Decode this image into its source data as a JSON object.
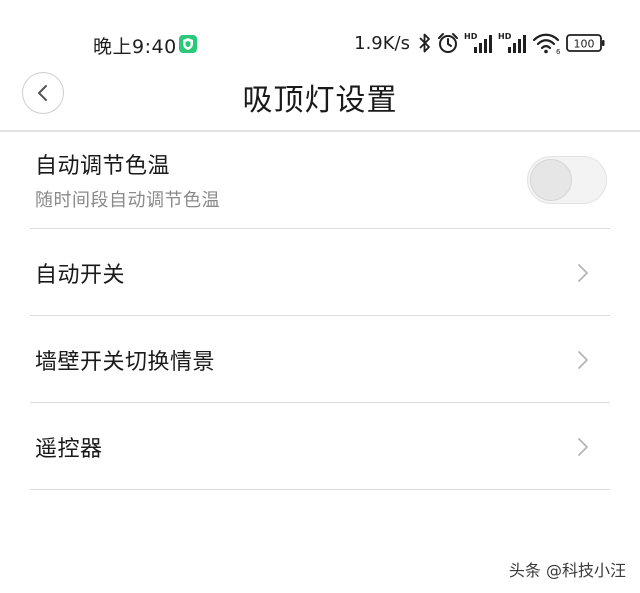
{
  "status_bar": {
    "time": "晚上9:40",
    "net_speed": "1.9K/s",
    "battery": "100",
    "hd_label": "HD",
    "wifi_badge": "6",
    "icons": [
      "shield-icon",
      "bluetooth-icon",
      "alarm-icon",
      "signal-icon",
      "signal-icon",
      "wifi-icon",
      "battery-icon"
    ]
  },
  "header": {
    "title": "吸顶灯设置",
    "back_icon": "chevron-left-icon"
  },
  "settings": {
    "auto_color_temp": {
      "title": "自动调节色温",
      "subtitle": "随时间段自动调节色温",
      "enabled": false
    },
    "items": [
      {
        "label": "自动开关"
      },
      {
        "label": "墙壁开关切换情景"
      },
      {
        "label": "遥控器"
      }
    ]
  },
  "watermark": "头条 @科技小汪",
  "colors": {
    "divider": "#dcdcdc",
    "subtitle": "#8a8a8a",
    "toggle_off": "#f3f3f3",
    "shield": "#2cc87a"
  }
}
